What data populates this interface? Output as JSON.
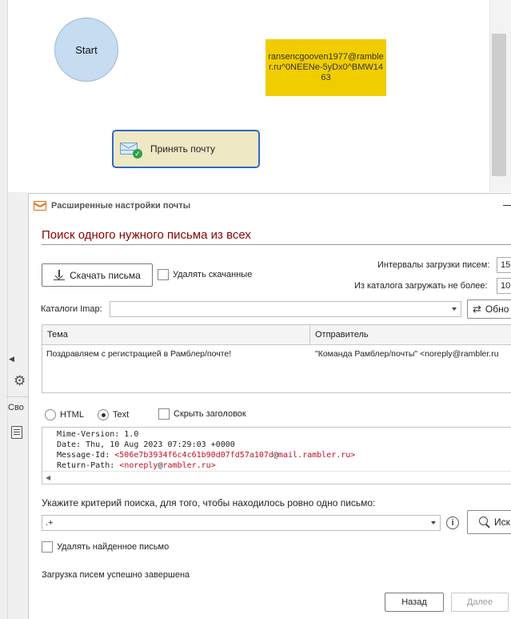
{
  "canvas": {
    "start_node": "Start",
    "note_node": "ransencgooven1977@rambler.ru^0NEENe-5yDx0^BMW1463",
    "action_node": "Принять почту"
  },
  "background_panel": {
    "tab_label": "Сво"
  },
  "dialog": {
    "title": "Расширенные настройки почты",
    "heading": "Поиск одного нужного письма из всех",
    "download_button": "Скачать письма",
    "delete_downloaded": "Удалять скачанные",
    "interval_label": "Интервалы загрузки писем:",
    "interval_value": "15",
    "maxload_label": "Из каталога загружать не более:",
    "maxload_value": "10",
    "imap_label": "Каталоги Imap:",
    "imap_value": "",
    "refresh_button": "Обно",
    "table": {
      "headers": [
        "Тема",
        "Отправитель"
      ],
      "rows": [
        {
          "subject": "Поздравляем с регистрацией в Рамблер/почте!",
          "sender": "\"Команда Рамблер/почты\"    <noreply@rambler.ru"
        }
      ]
    },
    "view": {
      "html_label": "HTML",
      "text_label": "Text",
      "selected": "Text",
      "hide_header_label": "Скрыть заголовок"
    },
    "raw": {
      "line1": "Mime-Version: 1.0",
      "line2": "Date: Thu, 10 Aug 2023 07:29:03 +0000",
      "line3_prefix": "Message-Id: ",
      "line3_lt": "<",
      "line3_id": "506e7b3934f6c4c61b90d07fd57a107d",
      "line3_at": "@",
      "line3_domain": "mail.rambler.ru",
      "line3_gt": ">",
      "line4_prefix": "Return-Path: ",
      "line4_lt": "<",
      "line4_user": "noreply",
      "line4_at": "@",
      "line4_domain": "rambler.ru",
      "line4_gt": ">"
    },
    "criteria_label": "Укажите критерий поиска, для того, чтобы находилось ровно одно письмо:",
    "criteria_value": ".+",
    "info_icon": "i",
    "search_button": "Иск",
    "delete_found": "Удалять найденное письмо",
    "status": "Загрузка писем успешно завершена",
    "back_button": "Назад",
    "next_button": "Далее"
  }
}
